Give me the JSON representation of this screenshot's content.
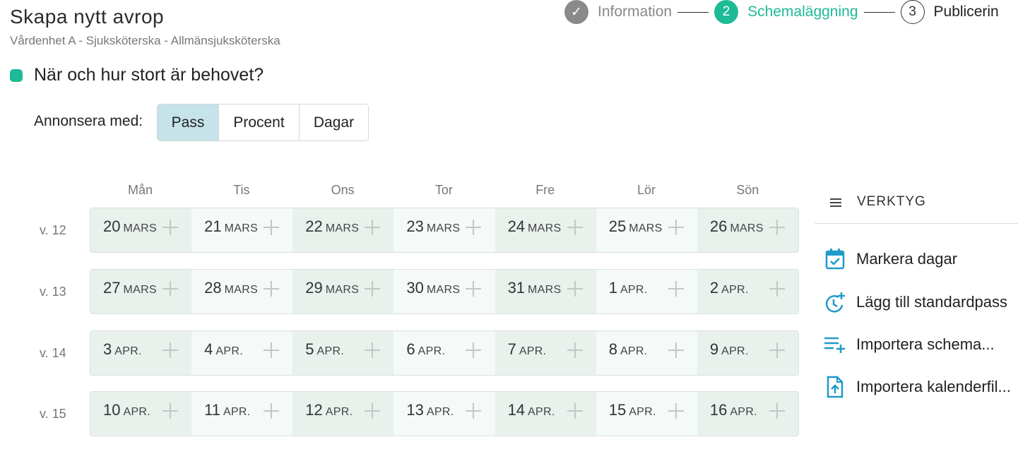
{
  "header": {
    "title": "Skapa nytt avrop",
    "subtitle": "Vårdenhet A - Sjuksköterska - Allmänsjuksköterska"
  },
  "stepper": [
    {
      "marker": "✓",
      "label": "Information",
      "state": "done"
    },
    {
      "marker": "2",
      "label": "Schemaläggning",
      "state": "active"
    },
    {
      "marker": "3",
      "label": "Publicerin",
      "state": "todo"
    }
  ],
  "section": {
    "title": "När och hur stort är behovet?"
  },
  "announce": {
    "label": "Annonsera med:",
    "options": [
      "Pass",
      "Procent",
      "Dagar"
    ],
    "selected": "Pass"
  },
  "calendar": {
    "days": [
      "Mån",
      "Tis",
      "Ons",
      "Tor",
      "Fre",
      "Lör",
      "Sön"
    ],
    "weeks": [
      {
        "label": "v. 12",
        "cells": [
          {
            "day": "20",
            "month": "MARS"
          },
          {
            "day": "21",
            "month": "MARS"
          },
          {
            "day": "22",
            "month": "MARS"
          },
          {
            "day": "23",
            "month": "MARS"
          },
          {
            "day": "24",
            "month": "MARS"
          },
          {
            "day": "25",
            "month": "MARS"
          },
          {
            "day": "26",
            "month": "MARS"
          }
        ]
      },
      {
        "label": "v. 13",
        "cells": [
          {
            "day": "27",
            "month": "MARS"
          },
          {
            "day": "28",
            "month": "MARS"
          },
          {
            "day": "29",
            "month": "MARS"
          },
          {
            "day": "30",
            "month": "MARS"
          },
          {
            "day": "31",
            "month": "MARS"
          },
          {
            "day": "1",
            "month": "APR."
          },
          {
            "day": "2",
            "month": "APR."
          }
        ]
      },
      {
        "label": "v. 14",
        "cells": [
          {
            "day": "3",
            "month": "APR."
          },
          {
            "day": "4",
            "month": "APR."
          },
          {
            "day": "5",
            "month": "APR."
          },
          {
            "day": "6",
            "month": "APR."
          },
          {
            "day": "7",
            "month": "APR."
          },
          {
            "day": "8",
            "month": "APR."
          },
          {
            "day": "9",
            "month": "APR."
          }
        ]
      },
      {
        "label": "v. 15",
        "cells": [
          {
            "day": "10",
            "month": "APR."
          },
          {
            "day": "11",
            "month": "APR."
          },
          {
            "day": "12",
            "month": "APR."
          },
          {
            "day": "13",
            "month": "APR."
          },
          {
            "day": "14",
            "month": "APR."
          },
          {
            "day": "15",
            "month": "APR."
          },
          {
            "day": "16",
            "month": "APR."
          }
        ]
      }
    ]
  },
  "tools": {
    "title": "VERKTYG",
    "items": [
      {
        "label": "Markera dagar",
        "icon": "calendar-check-icon"
      },
      {
        "label": "Lägg till standardpass",
        "icon": "clock-plus-icon"
      },
      {
        "label": "Importera schema...",
        "icon": "list-add-icon"
      },
      {
        "label": "Importera kalenderfil...",
        "icon": "file-upload-icon"
      }
    ]
  },
  "colors": {
    "accent": "#1dbb95",
    "tool_icon": "#1f9ac9",
    "selected_segment": "#c5e3e9"
  }
}
